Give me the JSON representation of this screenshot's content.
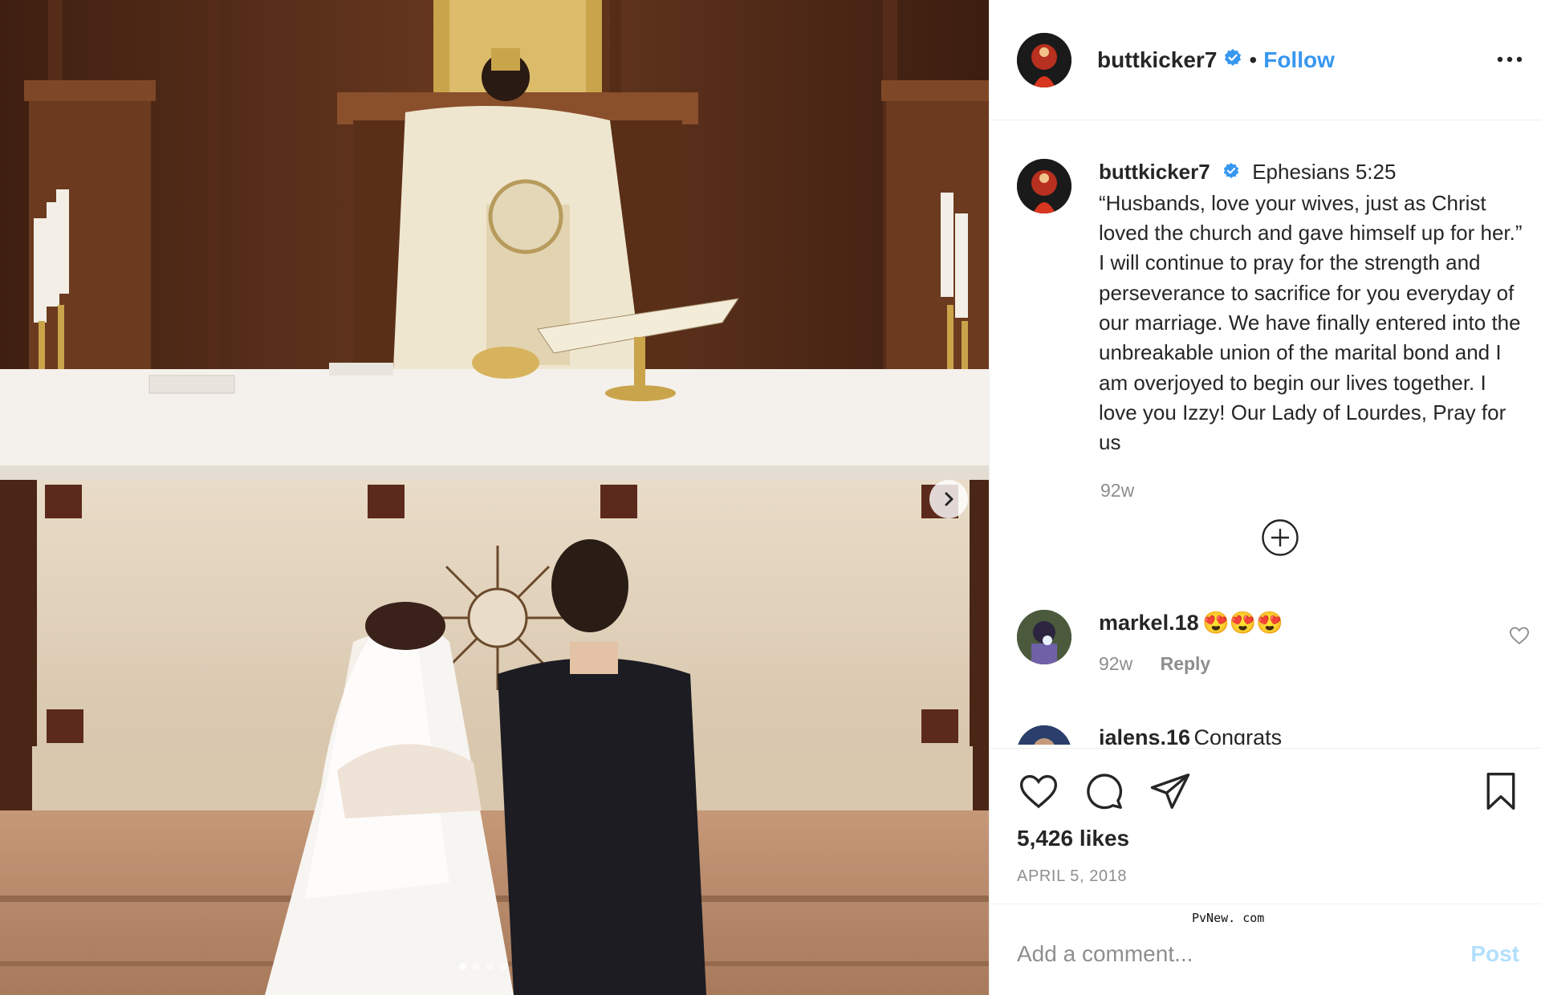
{
  "post": {
    "username": "buttkicker7",
    "follow_label": "Follow",
    "separator": "•",
    "caption": {
      "first_line": "Ephesians 5:25",
      "text": "“Husbands, love your wives, just as Christ loved the church and gave himself up for her.” I will continue to pray for the strength and perseverance to sacrifice for you everyday of our marriage. We have finally entered into the unbreakable union of the marital bond and I am overjoyed to begin our lives together. I love you Izzy! Our Lady of Lourdes, Pray for us",
      "timestamp": "92w"
    },
    "comments": [
      {
        "username": "markel.18",
        "text": "😍😍😍",
        "timestamp": "92w",
        "reply_label": "Reply"
      },
      {
        "username": "jalens.16",
        "text": "Congrats"
      }
    ],
    "likes": "5,426 likes",
    "date": "APRIL 5, 2018",
    "add_comment_placeholder": "Add a comment...",
    "post_button": "Post",
    "watermark": "PvNew. com",
    "carousel": {
      "total": 4,
      "active": 0
    }
  },
  "icons": {
    "verified": "verified-badge-icon",
    "more": "more-options-icon",
    "like": "heart-icon",
    "comment": "comment-bubble-icon",
    "share": "paper-plane-icon",
    "save": "bookmark-icon",
    "load_more": "plus-circle-icon",
    "next": "chevron-right-icon"
  },
  "colors": {
    "link": "#3897f0",
    "verified": "#3897f0",
    "muted": "#8e8e8e",
    "post_disabled": "#b2dffc"
  }
}
